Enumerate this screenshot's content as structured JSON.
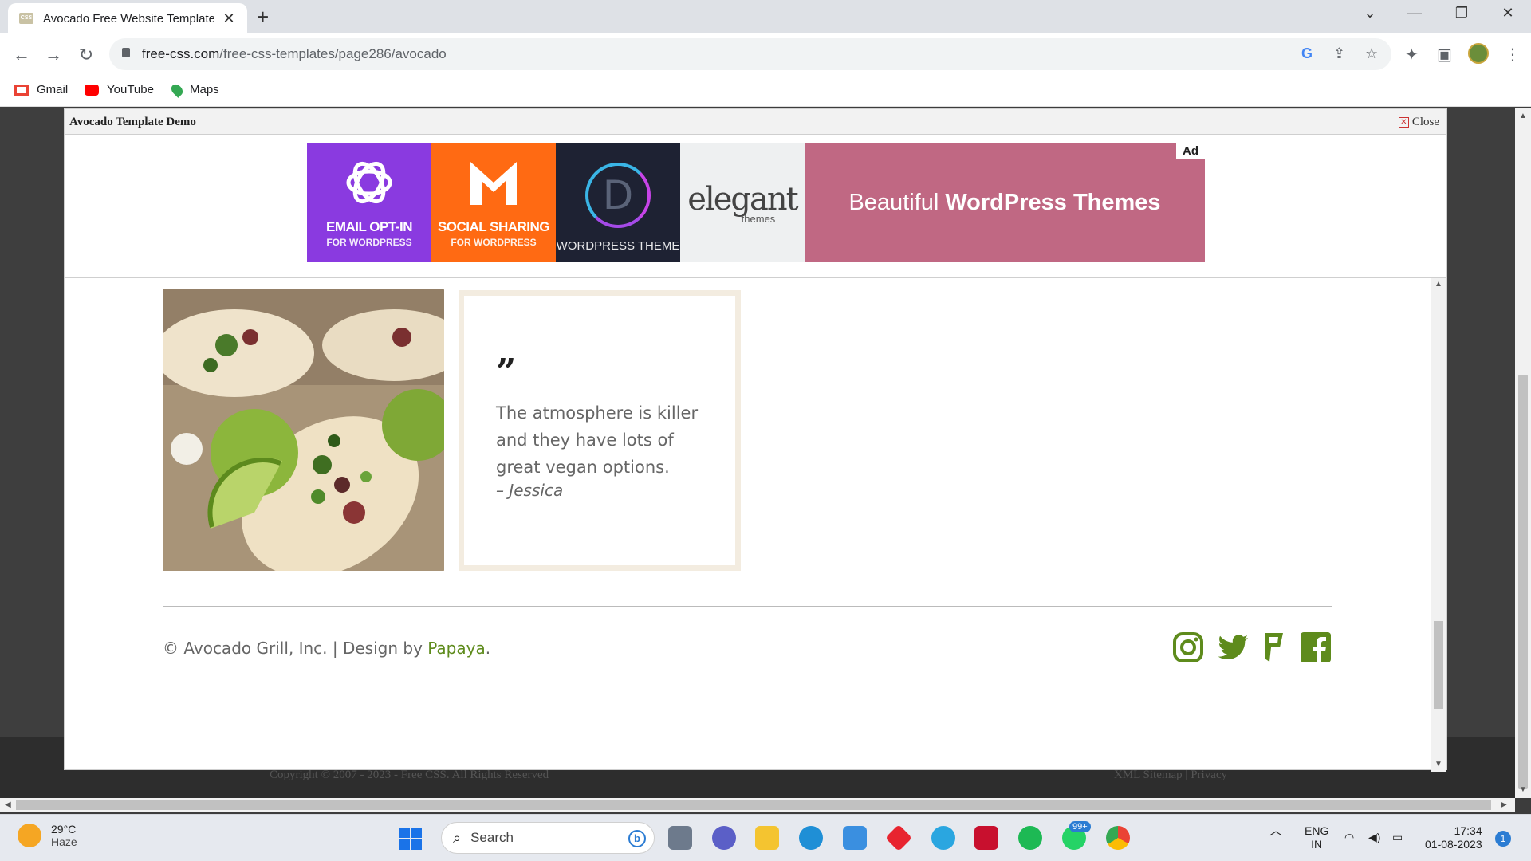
{
  "browser": {
    "tab_title": "Avocado Free Website Template",
    "url_domain": "free-css.com",
    "url_path": "/free-css-templates/page286/avocado",
    "bookmarks": [
      "Gmail",
      "YouTube",
      "Maps"
    ]
  },
  "demo": {
    "title": "Avocado Template Demo",
    "close_label": "Close"
  },
  "ad": {
    "label": "Ad",
    "tile1_big": "EMAIL OPT-IN",
    "tile1_small": "FOR WORDPRESS",
    "tile2_big": "SOCIAL SHARING",
    "tile2_small": "FOR WORDPRESS",
    "tile3_letter": "D",
    "tile3_small": "WORDPRESS THEME",
    "tile4_big": "elegant",
    "tile4_small": "themes",
    "banner_text": "Beautiful",
    "banner_bold": "WordPress Themes"
  },
  "testimonial": {
    "quote_mark": "”",
    "text": "The atmosphere is killer and they have lots of great vegan options.",
    "author": "– Jessica"
  },
  "footer": {
    "copyright_prefix": "© Avocado Grill, Inc. | Design by ",
    "design_link": "Papaya",
    "copyright_suffix": ".",
    "social": [
      "instagram",
      "twitter",
      "foursquare",
      "facebook"
    ]
  },
  "page_footer": {
    "left": "Copyright © 2007 - 2023 - Free CSS. All Rights Reserved",
    "right": "XML Sitemap | Privacy"
  },
  "taskbar": {
    "temperature": "29°C",
    "weather": "Haze",
    "search_placeholder": "Search",
    "whatsapp_badge": "99+",
    "language": "ENG",
    "region": "IN",
    "time": "17:34",
    "date": "01-08-2023",
    "notifications": "1"
  },
  "colors": {
    "accent_green": "#5e8b1c",
    "ad_purple": "#8a3ae0",
    "ad_orange": "#ff6a13",
    "ad_pink": "#c06883"
  }
}
